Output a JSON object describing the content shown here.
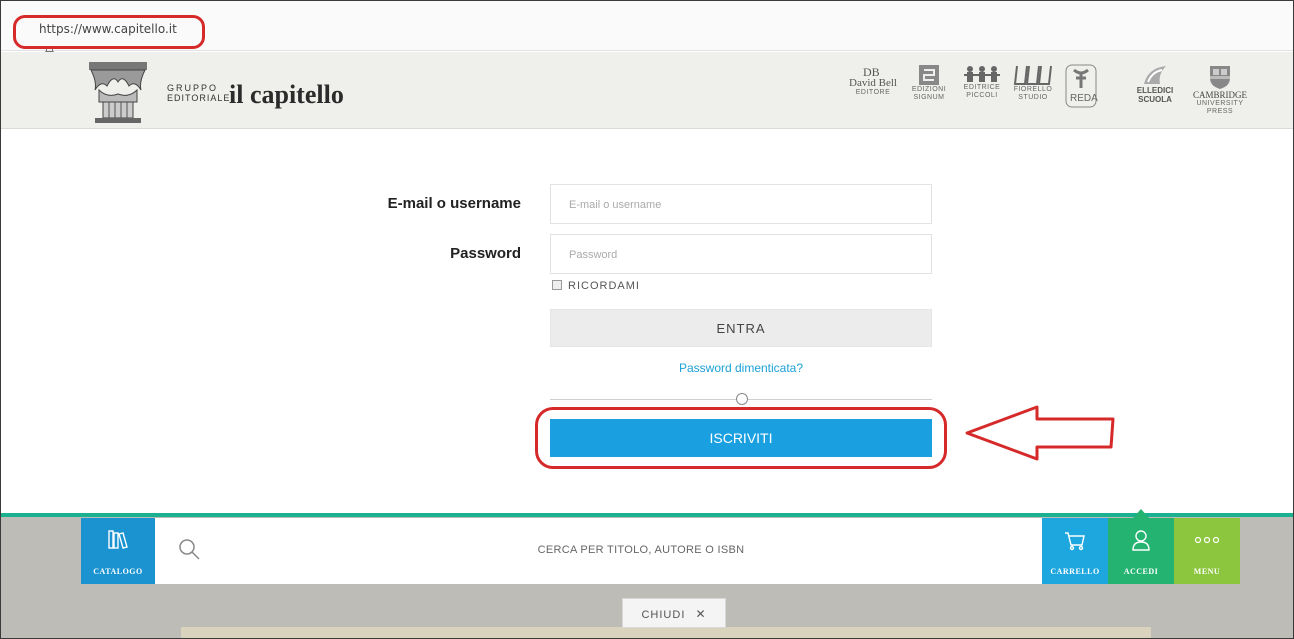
{
  "browser": {
    "url": "https://www.capitello.it"
  },
  "header": {
    "brand_small_line1": "GRUPPO",
    "brand_small_line2": "EDITORIALE",
    "brand_main": "il capitello",
    "partners": [
      {
        "name": "David Bell",
        "caption": "EDITORE"
      },
      {
        "name": "Edizioni Signum",
        "caption": "EDIZIONI SIGNUM"
      },
      {
        "name": "Editrice Piccoli",
        "caption": "EDITRICE PICCOLI"
      },
      {
        "name": "Fiorello Studio",
        "caption": "FIORELLO STUDIO"
      },
      {
        "name": "REDA",
        "caption": "REDA"
      },
      {
        "name": "ELLEDICI SCUOLA",
        "caption": "ELLEDICI SCUOLA"
      },
      {
        "name": "CAMBRIDGE",
        "caption": "UNIVERSITY PRESS"
      }
    ]
  },
  "login": {
    "email_label": "E-mail o username",
    "email_placeholder": "E-mail o username",
    "password_label": "Password",
    "password_placeholder": "Password",
    "remember_label": "RICORDAMI",
    "submit_label": "ENTRA",
    "forgot_label": "Password dimenticata?",
    "divider_symbol": "O",
    "register_label": "ISCRIVITI"
  },
  "bottom_bar": {
    "catalogo_label": "CATALOGO",
    "search_placeholder": "CERCA PER TITOLO, AUTORE O ISBN",
    "carrello_label": "CARRELLO",
    "accedi_label": "ACCEDI",
    "menu_label": "MENU",
    "close_label": "CHIUDI"
  },
  "colors": {
    "accent_blue": "#1a9fe0",
    "annotation_red": "#d62a2a",
    "accedi_green": "#24b371",
    "menu_green": "#8cc63f",
    "link_blue": "#1da1d6"
  },
  "icons": [
    "lock-icon",
    "capital-logo-icon",
    "search-icon",
    "catalog-books-icon",
    "cart-icon",
    "user-icon",
    "menu-dots-icon",
    "close-x-icon",
    "annotation-arrow"
  ]
}
